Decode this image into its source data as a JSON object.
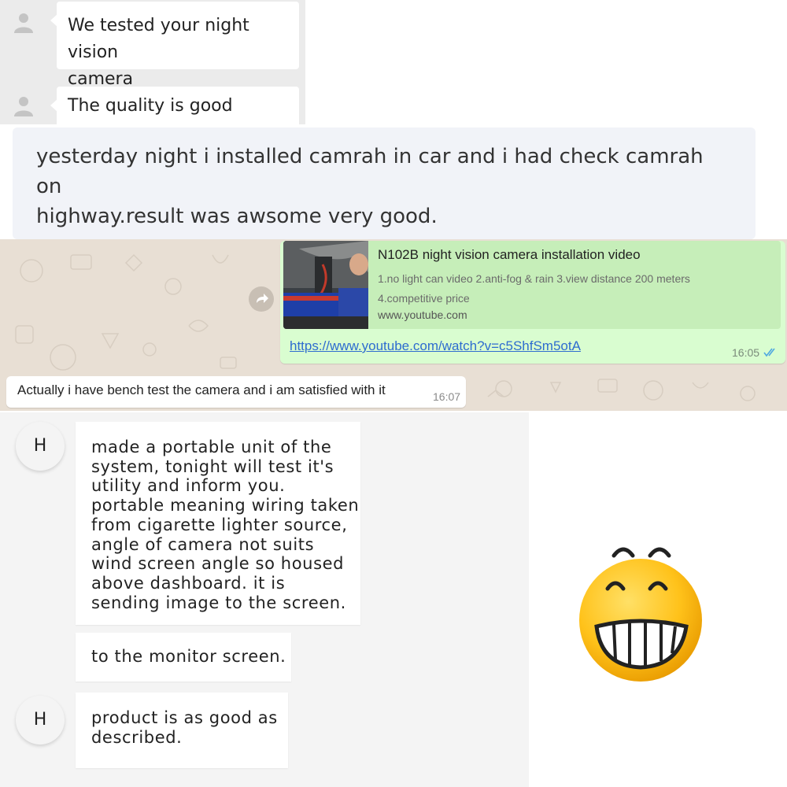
{
  "chat1": {
    "messages": [
      {
        "text": "We tested your night vision\ncamera"
      },
      {
        "text": "The quality is good"
      }
    ]
  },
  "chat2": {
    "message": "yesterday night i installed camrah in car and i had check  camrah  on\nhighway.result was awsome very good."
  },
  "whatsapp": {
    "link_preview": {
      "title": "N102B night vision camera installation video",
      "description": "1.no light can video 2.anti-fog & rain 3.view distance 200 meters\n4.competitive price",
      "site": "www.youtube.com"
    },
    "link_url": "https://www.youtube.com/watch?v=c5ShfSm5otA",
    "sent_time": "16:05",
    "received": {
      "text": "Actually i have bench test the camera and i am satisfied with it",
      "time": "16:07"
    }
  },
  "chat3": {
    "avatar_letter": "H",
    "messages": [
      {
        "text": "made a portable unit of the\nsystem, tonight will test it's\nutility and inform you.\nportable meaning wiring taken\nfrom cigarette lighter source,\nangle of camera not suits\nwind screen angle so housed\nabove dashboard. it is\nsending image to the screen."
      },
      {
        "text": "to the monitor screen."
      },
      {
        "text": "product is as good as\ndescribed."
      }
    ]
  },
  "emoji": {
    "name": "grinning-face-emoji"
  }
}
